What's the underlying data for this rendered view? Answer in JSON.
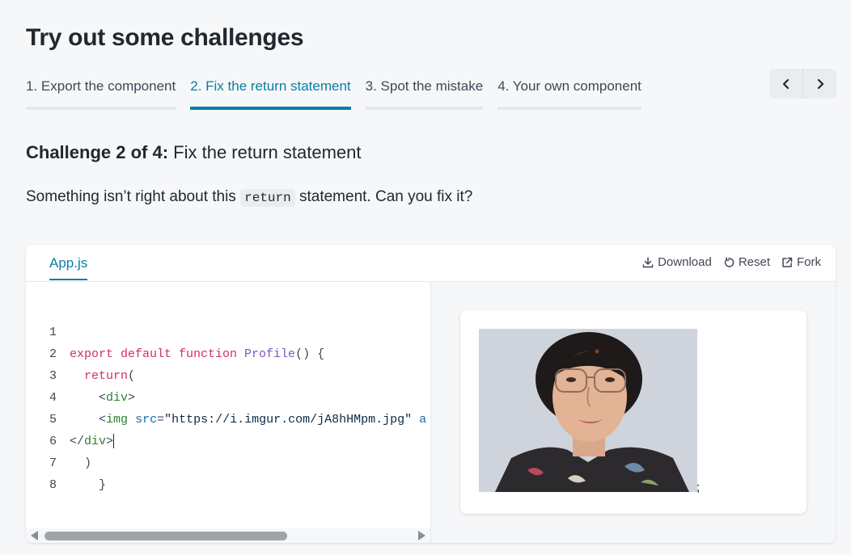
{
  "page": {
    "title": "Try out some challenges"
  },
  "tabs": [
    {
      "label": "1. Export the component",
      "active": false
    },
    {
      "label": "2. Fix the return statement",
      "active": true
    },
    {
      "label": "3. Spot the mistake",
      "active": false
    },
    {
      "label": "4. Your own component",
      "active": false
    }
  ],
  "pager": {
    "prev_icon": "chevron-left-icon",
    "next_icon": "chevron-right-icon"
  },
  "challenge": {
    "prefix": "Challenge 2 of 4:",
    "title": "Fix the return statement",
    "desc_before": "Something isn’t right about this ",
    "desc_code": "return",
    "desc_after": " statement. Can you fix it?"
  },
  "sandbox": {
    "file_tab": "App.js",
    "actions": {
      "download": "Download",
      "reset": "Reset",
      "fork": "Fork"
    },
    "line_numbers": [
      "1",
      "2",
      "3",
      "4",
      "5",
      "6",
      "7",
      "8"
    ],
    "code": {
      "l1_kw": "export default function ",
      "l1_fn": "Profile",
      "l1_rest": "() {",
      "l2_indent": "  ",
      "l2_kw": "return",
      "l2_rest": "(",
      "l3_indent": "    ",
      "l3_open": "<",
      "l3_tag": "div",
      "l3_close": ">",
      "l4_indent": "    ",
      "l4_open": "<",
      "l4_tag": "img",
      "l4_attr": "src",
      "l4_eq": "=",
      "l4_str": "\"https://i.imgur.com/jA8hHMpm.jpg\"",
      "l4_more": " a",
      "l5_open": "</",
      "l5_tag": "div",
      "l5_close": ">",
      "l6": "  )",
      "l7": "    }"
    },
    "preview": {
      "trailing_text": ";"
    }
  },
  "colors": {
    "accent": "#087ea4",
    "keyword": "#d1305c",
    "function": "#7e57c2",
    "tag": "#2e7d32"
  }
}
